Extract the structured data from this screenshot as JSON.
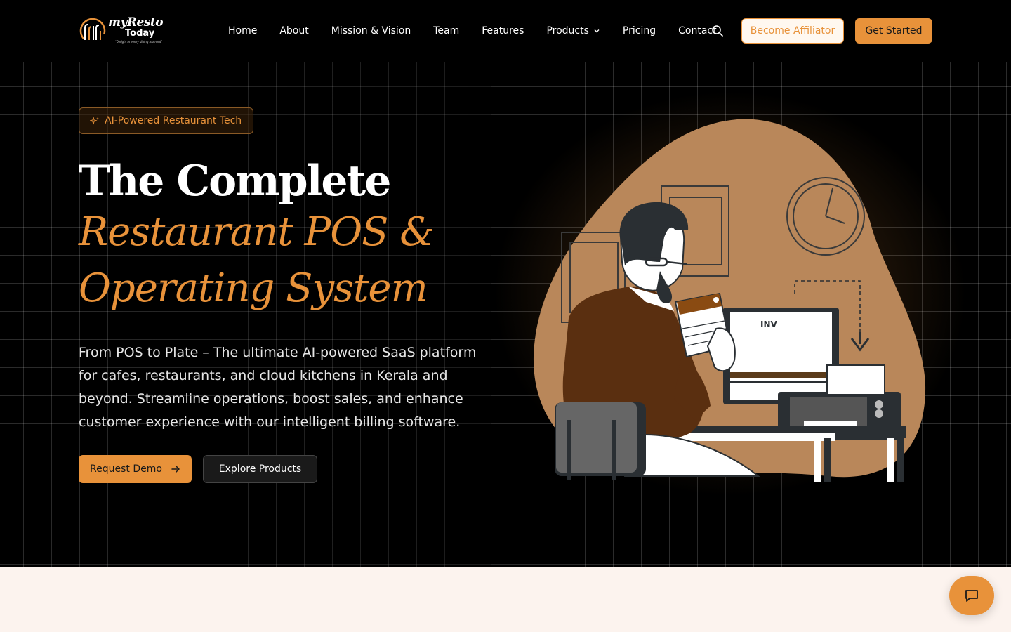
{
  "brand": {
    "name_part1": "myResto",
    "name_part2": "Today",
    "tagline": "\"Delight in every dining moment\"",
    "accent_color": "#e8923a"
  },
  "nav": {
    "links": [
      "Home",
      "About",
      "Mission & Vision",
      "Team",
      "Features",
      "Products",
      "Pricing",
      "Contact"
    ],
    "products_dropdown_icon": "chevron-down-icon",
    "search_icon": "search-icon",
    "affiliator_label": "Become Affiliator",
    "get_started_label": "Get Started"
  },
  "hero": {
    "badge": "AI-Powered Restaurant Tech",
    "badge_icon": "sparkle-icon",
    "title_line1": "The Complete",
    "title_line2": "Restaurant POS &",
    "title_line3": "Operating System",
    "lead": "From POS to Plate – The ultimate AI-powered SaaS platform for cafes, restaurants, and cloud kitchens in Kerala and beyond. Streamline operations, boost sales, and enhance customer experience with our intelligent billing software.",
    "primary_cta": "Request Demo",
    "primary_cta_icon": "arrow-right-icon",
    "secondary_cta": "Explore Products",
    "illustration_label": "INV"
  },
  "chat": {
    "icon": "chat-icon"
  }
}
